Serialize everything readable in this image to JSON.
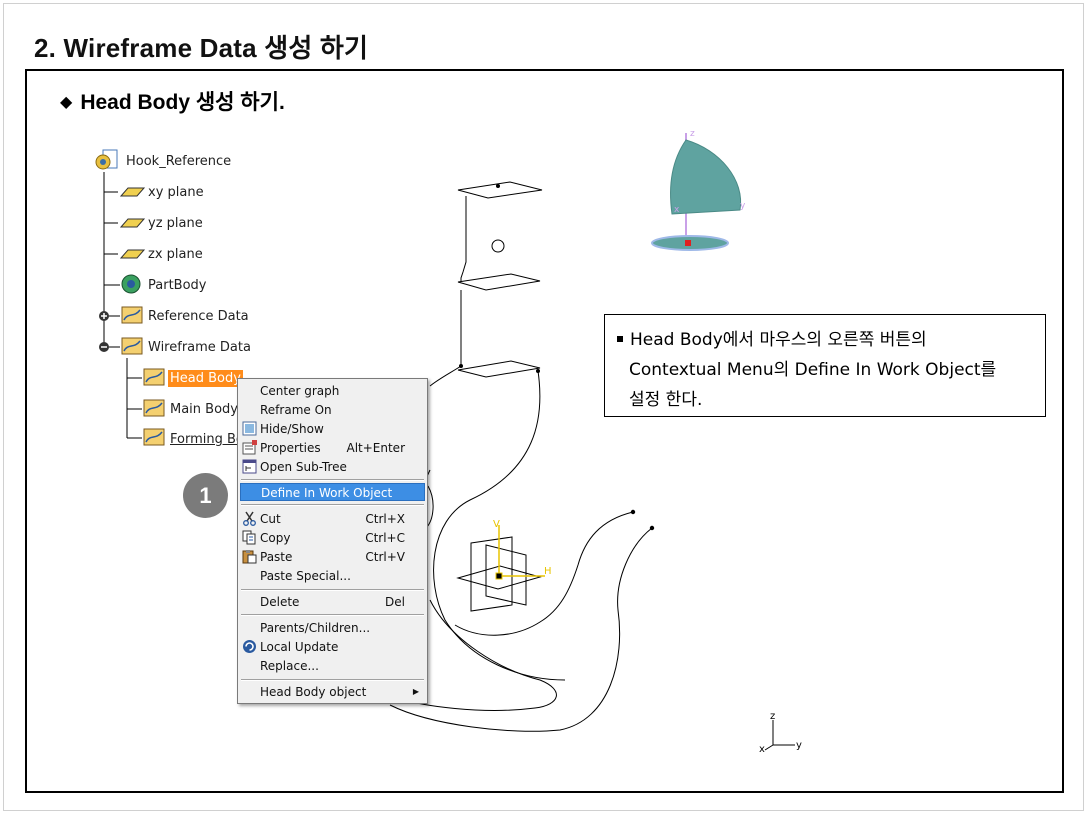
{
  "slide": {
    "title": "2. Wireframe Data 생성 하기",
    "subheading": "Head Body 생성 하기.",
    "subheading_bullet": "◆"
  },
  "tree": {
    "root": "Hook_Reference",
    "items": [
      {
        "label": "xy plane",
        "icon": "plane-icon"
      },
      {
        "label": "yz plane",
        "icon": "plane-icon"
      },
      {
        "label": "zx plane",
        "icon": "plane-icon"
      },
      {
        "label": "PartBody",
        "icon": "partbody-icon"
      },
      {
        "label": "Reference Data",
        "icon": "geometrical-set-icon"
      },
      {
        "label": "Wireframe Data",
        "icon": "geometrical-set-icon"
      }
    ],
    "children": [
      {
        "label": "Head Body",
        "icon": "geometrical-set-icon",
        "state": "selected"
      },
      {
        "label": "Main Body",
        "icon": "geometrical-set-icon"
      },
      {
        "label": "Forming Bo",
        "icon": "geometrical-set-icon",
        "state": "in-work"
      }
    ]
  },
  "context_menu": {
    "center_graph": "Center graph",
    "reframe_on": "Reframe On",
    "hide_show": "Hide/Show",
    "properties": "Properties",
    "properties_shortcut": "Alt+Enter",
    "open_sub_tree": "Open Sub-Tree",
    "define_in_work_object": "Define In Work Object",
    "cut": "Cut",
    "cut_shortcut": "Ctrl+X",
    "copy": "Copy",
    "copy_shortcut": "Ctrl+C",
    "paste": "Paste",
    "paste_shortcut": "Ctrl+V",
    "paste_special": "Paste Special...",
    "delete": "Delete",
    "delete_shortcut": "Del",
    "parents_children": "Parents/Children...",
    "local_update": "Local Update",
    "replace": "Replace...",
    "head_body_object": "Head Body object",
    "highlight_color": "#3d8ee4"
  },
  "step_badge": "1",
  "callout": {
    "line1": "Head Body에서 마우스의 오른쪽 버튼의",
    "line2": "Contextual Menu의 Define In Work Object를",
    "line3": "설정 한다."
  },
  "compass_labels": {
    "z": "z",
    "y": "y",
    "x": "x"
  },
  "axis_labels": {
    "v": "V",
    "h": "H",
    "z": "z",
    "y": "y",
    "x": "x"
  },
  "colors": {
    "selection": "#ff8c1a",
    "compass_fill": "#5fa3a0",
    "axis_yellow": "#e8c400"
  }
}
